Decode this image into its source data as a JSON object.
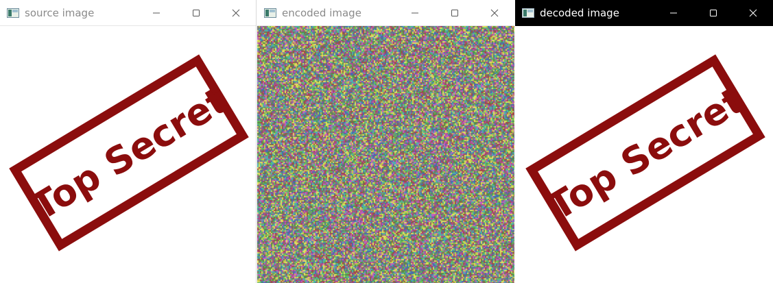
{
  "windows": [
    {
      "title": "source image",
      "active": false,
      "icon": "image-window-icon",
      "image": {
        "kind": "stamp",
        "stamp_text": "Top Secret",
        "color": "#8b0d0d"
      }
    },
    {
      "title": "encoded image",
      "active": false,
      "icon": "image-window-icon",
      "image": {
        "kind": "noise",
        "palette": [
          "#5a8a4a",
          "#b04a8a",
          "#4a6ab0",
          "#c8c84a",
          "#4ab0b0",
          "#a04a4a",
          "#7a7a7a",
          "#e0e060",
          "#60c060",
          "#c060c0"
        ]
      }
    },
    {
      "title": "decoded image",
      "active": true,
      "icon": "image-window-icon",
      "image": {
        "kind": "stamp",
        "stamp_text": "Top Secret",
        "color": "#8b0d0d"
      }
    }
  ],
  "controls": {
    "minimize": "minimize-icon",
    "maximize": "maximize-icon",
    "close": "close-icon"
  }
}
